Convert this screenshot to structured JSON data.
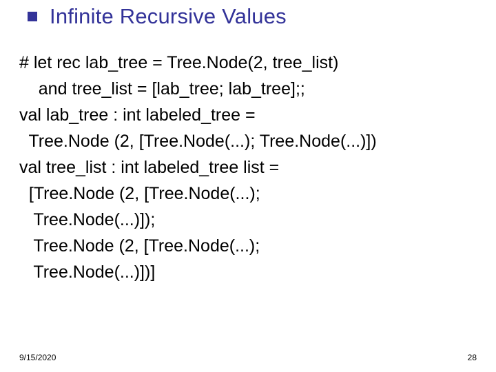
{
  "title": "Infinite Recursive Values",
  "body": {
    "lines": [
      "# let rec lab_tree = Tree.Node(2, tree_list)",
      "    and tree_list = [lab_tree; lab_tree];;",
      "val lab_tree : int labeled_tree =",
      "  Tree.Node (2, [Tree.Node(...); Tree.Node(...)])",
      "val tree_list : int labeled_tree list =",
      "  [Tree.Node (2, [Tree.Node(...);",
      "   Tree.Node(...)]);",
      "   Tree.Node (2, [Tree.Node(...);",
      "   Tree.Node(...)])]"
    ]
  },
  "footer": {
    "date": "9/15/2020",
    "page": "28"
  }
}
